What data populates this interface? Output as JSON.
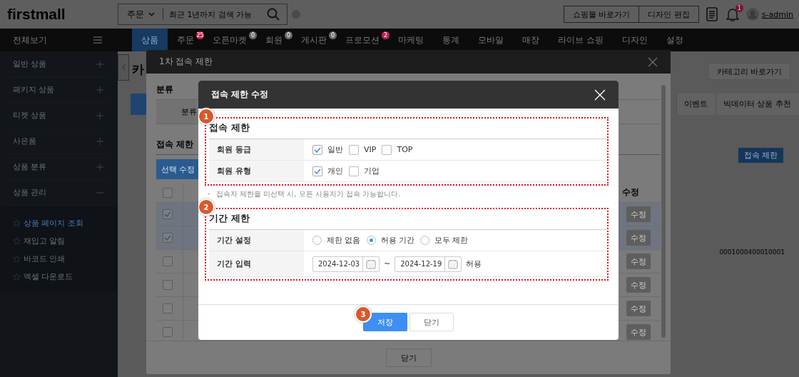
{
  "header": {
    "logo": "firstmall",
    "search_scope": "주문",
    "search_placeholder": "최근 1년까지 검색 가능",
    "buttons": [
      "쇼핑몰 바로가기",
      "디자인 편집"
    ],
    "notification_count": "1",
    "user": "s-admin"
  },
  "sidebar": {
    "title": "전체보기",
    "groups": [
      {
        "label": "일반 상품",
        "expanded": false
      },
      {
        "label": "패키지 상품",
        "expanded": false
      },
      {
        "label": "티켓 상품",
        "expanded": false
      },
      {
        "label": "사은품",
        "expanded": false
      },
      {
        "label": "상품 분류",
        "expanded": false
      },
      {
        "label": "상품 관리",
        "expanded": true,
        "children": [
          {
            "label": "상품 페이지 조회",
            "selected": true
          },
          {
            "label": "재입고 알림",
            "selected": false
          },
          {
            "label": "바코드 인쇄",
            "selected": false
          },
          {
            "label": "엑셀 다운로드",
            "selected": false
          }
        ]
      }
    ]
  },
  "nav": [
    {
      "label": "상품",
      "selected": true
    },
    {
      "label": "주문",
      "selected": false,
      "badge": {
        "text": "25",
        "color": "#c4234f"
      }
    },
    {
      "label": "오픈마켓",
      "selected": false,
      "badge": {
        "text": "0",
        "color": "#6b6b6b"
      }
    },
    {
      "label": "회원",
      "selected": false,
      "badge": {
        "text": "0",
        "color": "#6b6b6b"
      }
    },
    {
      "label": "게시판",
      "selected": false,
      "badge": {
        "text": "0",
        "color": "#6b6b6b"
      }
    },
    {
      "label": "프로모션",
      "selected": false,
      "badge": {
        "text": "2",
        "color": "#c4234f"
      }
    },
    {
      "label": "마케팅",
      "selected": false
    },
    {
      "label": "통계",
      "selected": false
    },
    {
      "label": "모바일",
      "selected": false
    },
    {
      "label": "매장",
      "selected": false
    },
    {
      "label": "라이브 쇼핑",
      "selected": false
    },
    {
      "label": "디자인",
      "selected": false
    },
    {
      "label": "설정",
      "selected": false
    }
  ],
  "page": {
    "title": "카",
    "category_button": "카테고리 바로가기",
    "tabs": [
      "이벤트",
      "빅데이터 상품 추천"
    ],
    "access_button": "접속 제한",
    "code": "0001000400010001"
  },
  "outer_dialog": {
    "title": "1차 접속 제한",
    "section_1": "분류",
    "row_label": "분류",
    "section_2": "접속 제한",
    "bulk_button": "선택 수정",
    "column_edit": "수정",
    "header_checked": false,
    "rows": [
      {
        "checked": true,
        "edit": "수정"
      },
      {
        "checked": true,
        "edit": "수정"
      },
      {
        "checked": false,
        "edit": "수정"
      },
      {
        "checked": false,
        "edit": "수정"
      },
      {
        "checked": false,
        "edit": "수정"
      },
      {
        "checked": false,
        "edit": "수정"
      }
    ],
    "close_button": "닫기"
  },
  "dialog": {
    "title": "접속 제한 수정",
    "access": {
      "callout": "1",
      "title": "접속 제한",
      "rows": [
        {
          "label": "회원 등급",
          "options": [
            {
              "label": "일반",
              "checked": true
            },
            {
              "label": "VIP",
              "checked": false
            },
            {
              "label": "TOP",
              "checked": false
            }
          ]
        },
        {
          "label": "회원 유형",
          "options": [
            {
              "label": "개인",
              "checked": true
            },
            {
              "label": "기업",
              "checked": false
            }
          ]
        }
      ]
    },
    "note_marker": "-",
    "note": "접속자 제한을 미선택 시, 모든 사용자가 접속 가능합니다.",
    "period": {
      "callout": "2",
      "title": "기간 제한",
      "setting_label": "기간 설정",
      "choices": [
        {
          "label": "제한 없음",
          "selected": false
        },
        {
          "label": "허용 기간",
          "selected": true
        },
        {
          "label": "모두 제한",
          "selected": false
        }
      ],
      "input_label": "기간 입력",
      "start": "2024-12-03",
      "separator": "~",
      "end": "2024-12-19",
      "suffix": "허용"
    },
    "save_callout": "3",
    "save_button": "저장",
    "close_button": "닫기"
  }
}
